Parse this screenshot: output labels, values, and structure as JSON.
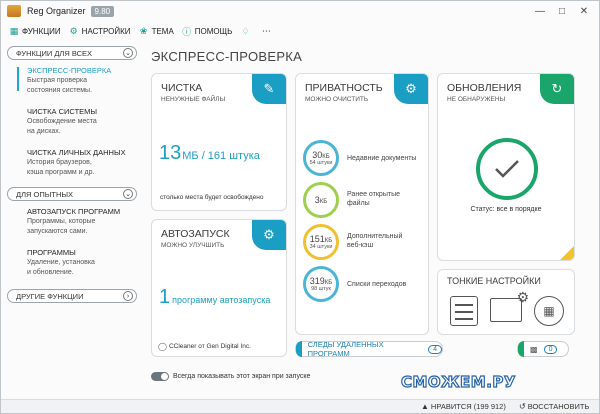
{
  "app": {
    "title": "Reg Organizer",
    "version": "9.80",
    "window_controls": [
      "minimize-icon",
      "maximize-icon",
      "close-icon"
    ]
  },
  "menu": {
    "items": [
      {
        "label": "ФУНКЦИИ",
        "icon": "grid-icon"
      },
      {
        "label": "НАСТРОЙКИ",
        "icon": "gear-icon"
      },
      {
        "label": "ТЕМА",
        "icon": "brush-icon"
      },
      {
        "label": "ПОМОЩЬ",
        "icon": "help-icon"
      }
    ],
    "extra_icons": [
      "bell-icon",
      "more-icon"
    ]
  },
  "sidebar": {
    "group1": "ФУНКЦИИ ДЛЯ ВСЕХ",
    "items1": [
      {
        "title": "ЭКСПРЕСС-ПРОВЕРКА",
        "desc1": "Быстрая проверка",
        "desc2": "состояния системы."
      },
      {
        "title": "ЧИСТКА СИСТЕМЫ",
        "desc1": "Освобождение места",
        "desc2": "на дисках."
      },
      {
        "title": "ЧИСТКА ЛИЧНЫХ ДАННЫХ",
        "desc1": "История браузеров,",
        "desc2": "кэша программ и др."
      }
    ],
    "group2": "ДЛЯ ОПЫТНЫХ",
    "items2": [
      {
        "title": "АВТОЗАПУСК ПРОГРАММ",
        "desc1": "Программы, которые",
        "desc2": "запускаются сами."
      },
      {
        "title": "ПРОГРАММЫ",
        "desc1": "Удаление, установка",
        "desc2": "и обновление."
      }
    ],
    "group3": "ДРУГИЕ ФУНКЦИИ"
  },
  "main": {
    "title": "ЭКСПРЕСС-ПРОВЕРКА",
    "cleaning": {
      "title": "ЧИСТКА",
      "subtitle": "НЕНУЖНЫЕ ФАЙЛЫ",
      "size": "13",
      "unit": "МБ / 161 штука",
      "footer": "столько места будет освобождено"
    },
    "autorun": {
      "title": "АВТОЗАПУСК",
      "subtitle": "МОЖНО УЛУЧШИТЬ",
      "count": "1",
      "text": "программу автозапуска",
      "footer": "CCleaner от Gen Digital Inc."
    },
    "privacy": {
      "title": "ПРИВАТНОСТЬ",
      "subtitle": "МОЖНО ОЧИСТИТЬ",
      "items": [
        {
          "value": "30",
          "unit": "КБ",
          "count": "54 штуки",
          "label1": "Недавние документы",
          "label2": "",
          "color": "#4bb5d6"
        },
        {
          "value": "3",
          "unit": "КБ",
          "count": "",
          "label1": "Ранее открытые",
          "label2": "файлы",
          "color": "#9fcf4e"
        },
        {
          "value": "151",
          "unit": "КБ",
          "count": "34 штуки",
          "label1": "Дополнительный",
          "label2": "веб-кэш",
          "color": "#f0c030"
        },
        {
          "value": "319",
          "unit": "КБ",
          "count": "98 штук",
          "label1": "Списки переходов",
          "label2": "",
          "color": "#4bb5d6"
        }
      ]
    },
    "updates": {
      "title": "ОБНОВЛЕНИЯ",
      "subtitle": "НЕ ОБНАРУЖЕНЫ",
      "status": "Статус: все в порядке"
    },
    "tuning": {
      "title": "ТОНКИЕ НАСТРОЙКИ"
    },
    "removed_traces": {
      "label": "СЛЕДЫ УДАЛЕННЫХ ПРОГРАММ",
      "count": "4"
    },
    "extra_pill": {
      "count": "0"
    },
    "show_on_start": "Всегда показывать этот экран при запуске"
  },
  "status_bar": {
    "likes": "НРАВИТСЯ (199 912)",
    "restore": "ВОССТАНОВИТЬ"
  },
  "watermark": "СМОЖЕМ.РУ",
  "colors": {
    "accent_blue": "#1a9ec3",
    "accent_green": "#1aa56a",
    "accent_teal": "#1a9d8f",
    "yellow": "#f2c12e"
  }
}
